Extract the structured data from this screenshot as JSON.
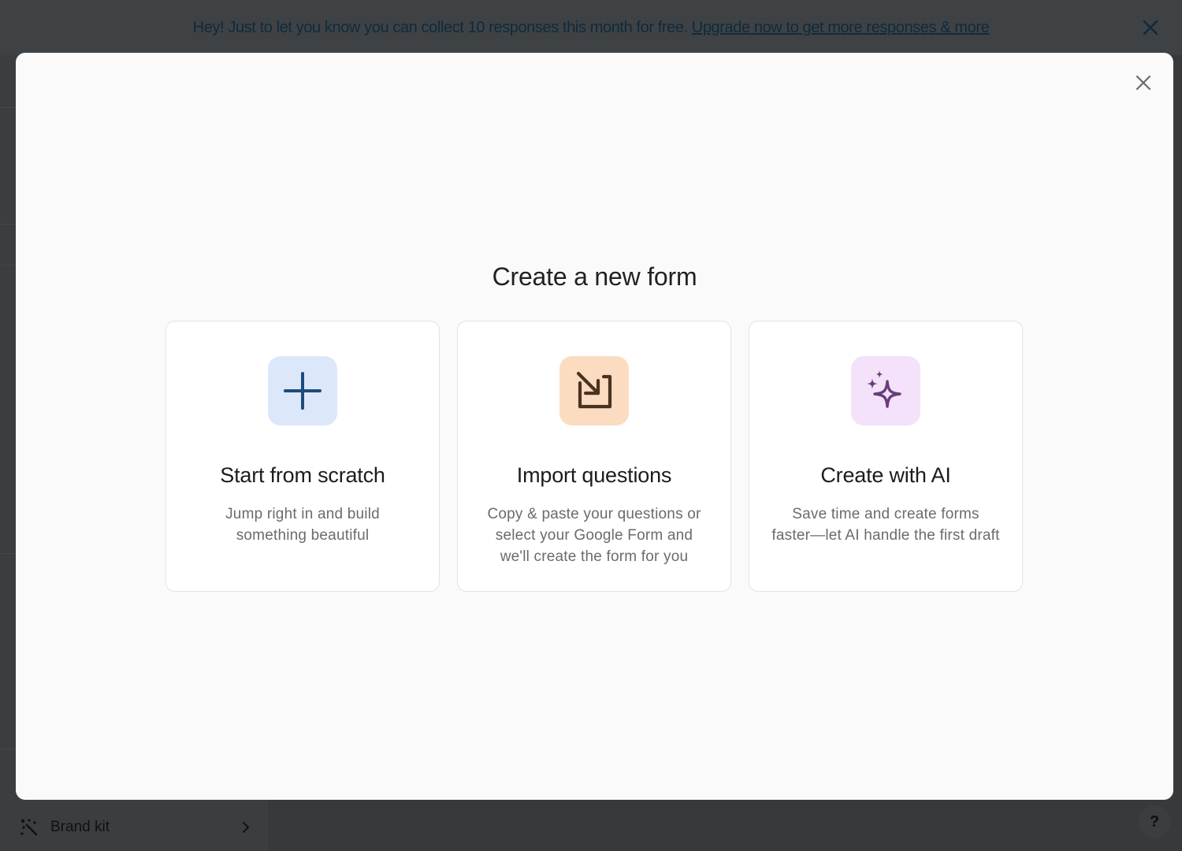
{
  "banner": {
    "text": "Hey! Just to let you know you can collect 10 responses this month for free.",
    "link": "Upgrade now to get more responses & more",
    "close_icon": "close-icon"
  },
  "sidebar": {
    "brand_kit_label": "Brand kit",
    "brand_kit_icon": "sparkle-dots-icon",
    "chevron_icon": "chevron-right-icon"
  },
  "help": {
    "label": "?"
  },
  "modal": {
    "title": "Create a new form",
    "close_icon": "close-icon",
    "options": [
      {
        "title": "Start from scratch",
        "description": "Jump right in and build something beautiful",
        "icon": "plus-icon",
        "icon_bg": "#dce7fa",
        "icon_color": "#1f4b7a"
      },
      {
        "title": "Import questions",
        "description": "Copy & paste your questions or select your Google Form and we'll create the form for you",
        "icon": "import-arrow-icon",
        "icon_bg": "#fbdcc0",
        "icon_color": "#4a3320"
      },
      {
        "title": "Create with AI",
        "description": "Save time and create forms faster—let AI handle the first draft",
        "icon": "sparkles-icon",
        "icon_bg": "#f3e2fa",
        "icon_color": "#6b3d78"
      }
    ]
  },
  "colors": {
    "overlay": "#3a3c3e",
    "modal_bg": "#fafafa",
    "card_border": "#e3e3e3"
  }
}
